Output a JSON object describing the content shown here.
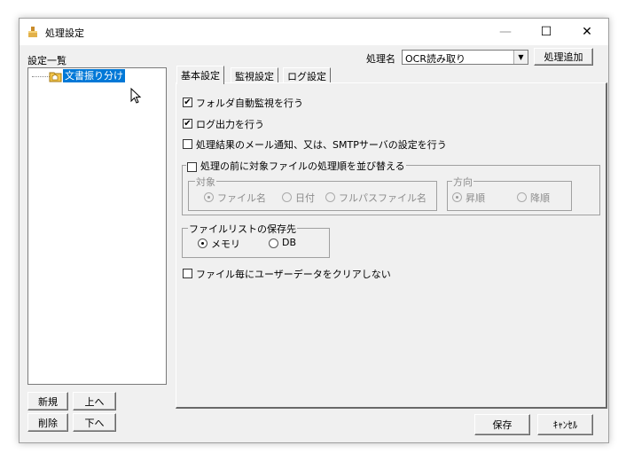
{
  "window": {
    "title": "処理設定",
    "minimize": "—",
    "maximize": "☐",
    "close": "✕"
  },
  "list": {
    "label": "設定一覧",
    "items": [
      {
        "label": "文書振り分け",
        "selected": true
      }
    ]
  },
  "left_buttons": {
    "new": "新規",
    "up": "上へ",
    "delete": "削除",
    "down": "下へ"
  },
  "process": {
    "label": "処理名",
    "selected": "OCR読み取り",
    "add_button": "処理追加"
  },
  "tabs": [
    {
      "label": "基本設定",
      "active": true
    },
    {
      "label": "監視設定"
    },
    {
      "label": "ログ設定"
    }
  ],
  "options": {
    "folder_monitor": {
      "label": "フォルダ自動監視を行う",
      "checked": true
    },
    "log_output": {
      "label": "ログ出力を行う",
      "checked": true
    },
    "mail_notify": {
      "label": "処理結果のメール通知、又は、SMTPサーバの設定を行う",
      "checked": false
    },
    "sort_group": {
      "label": "処理の前に対象ファイルの処理順を並び替える",
      "checked": false,
      "target": {
        "label": "対象",
        "options": [
          "ファイル名",
          "日付",
          "フルパスファイル名"
        ],
        "selected": "ファイル名"
      },
      "direction": {
        "label": "方向",
        "options": [
          "昇順",
          "降順"
        ],
        "selected": "昇順"
      }
    },
    "filelist": {
      "label": "ファイルリストの保存先",
      "options": [
        "メモリ",
        "DB"
      ],
      "selected": "メモリ"
    },
    "no_clear": {
      "label": "ファイル毎にユーザーデータをクリアしない",
      "checked": false
    }
  },
  "footer": {
    "save": "保存",
    "cancel": "ｷｬﾝｾﾙ"
  },
  "check_mark": "✔"
}
